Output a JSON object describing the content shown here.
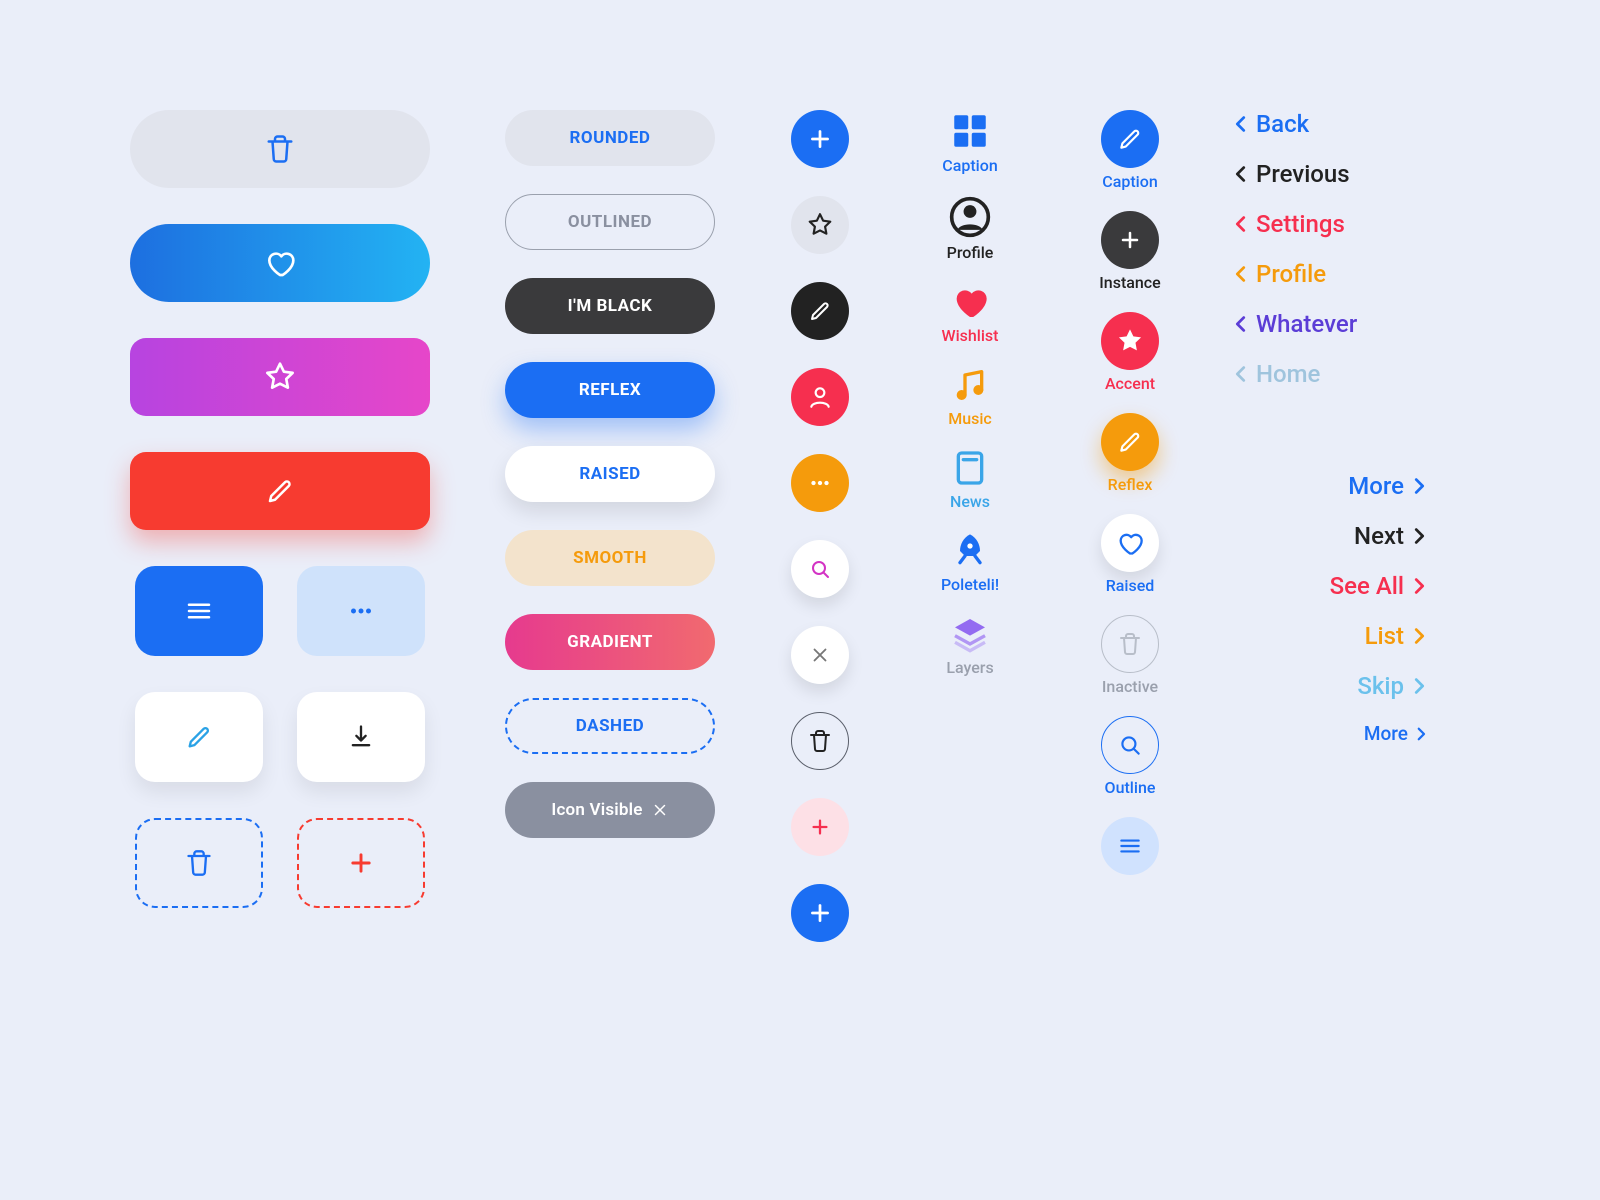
{
  "pills": {
    "rounded": "ROUNDED",
    "outlined": "OUTLINED",
    "black": "I'M BLACK",
    "reflex": "REFLEX",
    "raised": "RAISED",
    "smooth": "SMOOTH",
    "gradient": "GRADIENT",
    "dashed": "DASHED",
    "iconvis": "Icon Visible"
  },
  "captioned_icons": {
    "grid": "Caption",
    "profile": "Profile",
    "wishlist": "Wishlist",
    "music": "Music",
    "news": "News",
    "rocket": "Poleteli!",
    "layers": "Layers"
  },
  "captioned_circles": {
    "pencil": "Caption",
    "instance": "Instance",
    "accent": "Accent",
    "reflex": "Reflex",
    "raised": "Raised",
    "inactive": "Inactive",
    "outline": "Outline"
  },
  "nav_back": {
    "back": "Back",
    "previous": "Previous",
    "settings": "Settings",
    "profile": "Profile",
    "whatever": "Whatever",
    "home": "Home"
  },
  "nav_fwd": {
    "more": "More",
    "next": "Next",
    "seeall": "See All",
    "list": "List",
    "skip": "Skip",
    "more2": "More"
  }
}
